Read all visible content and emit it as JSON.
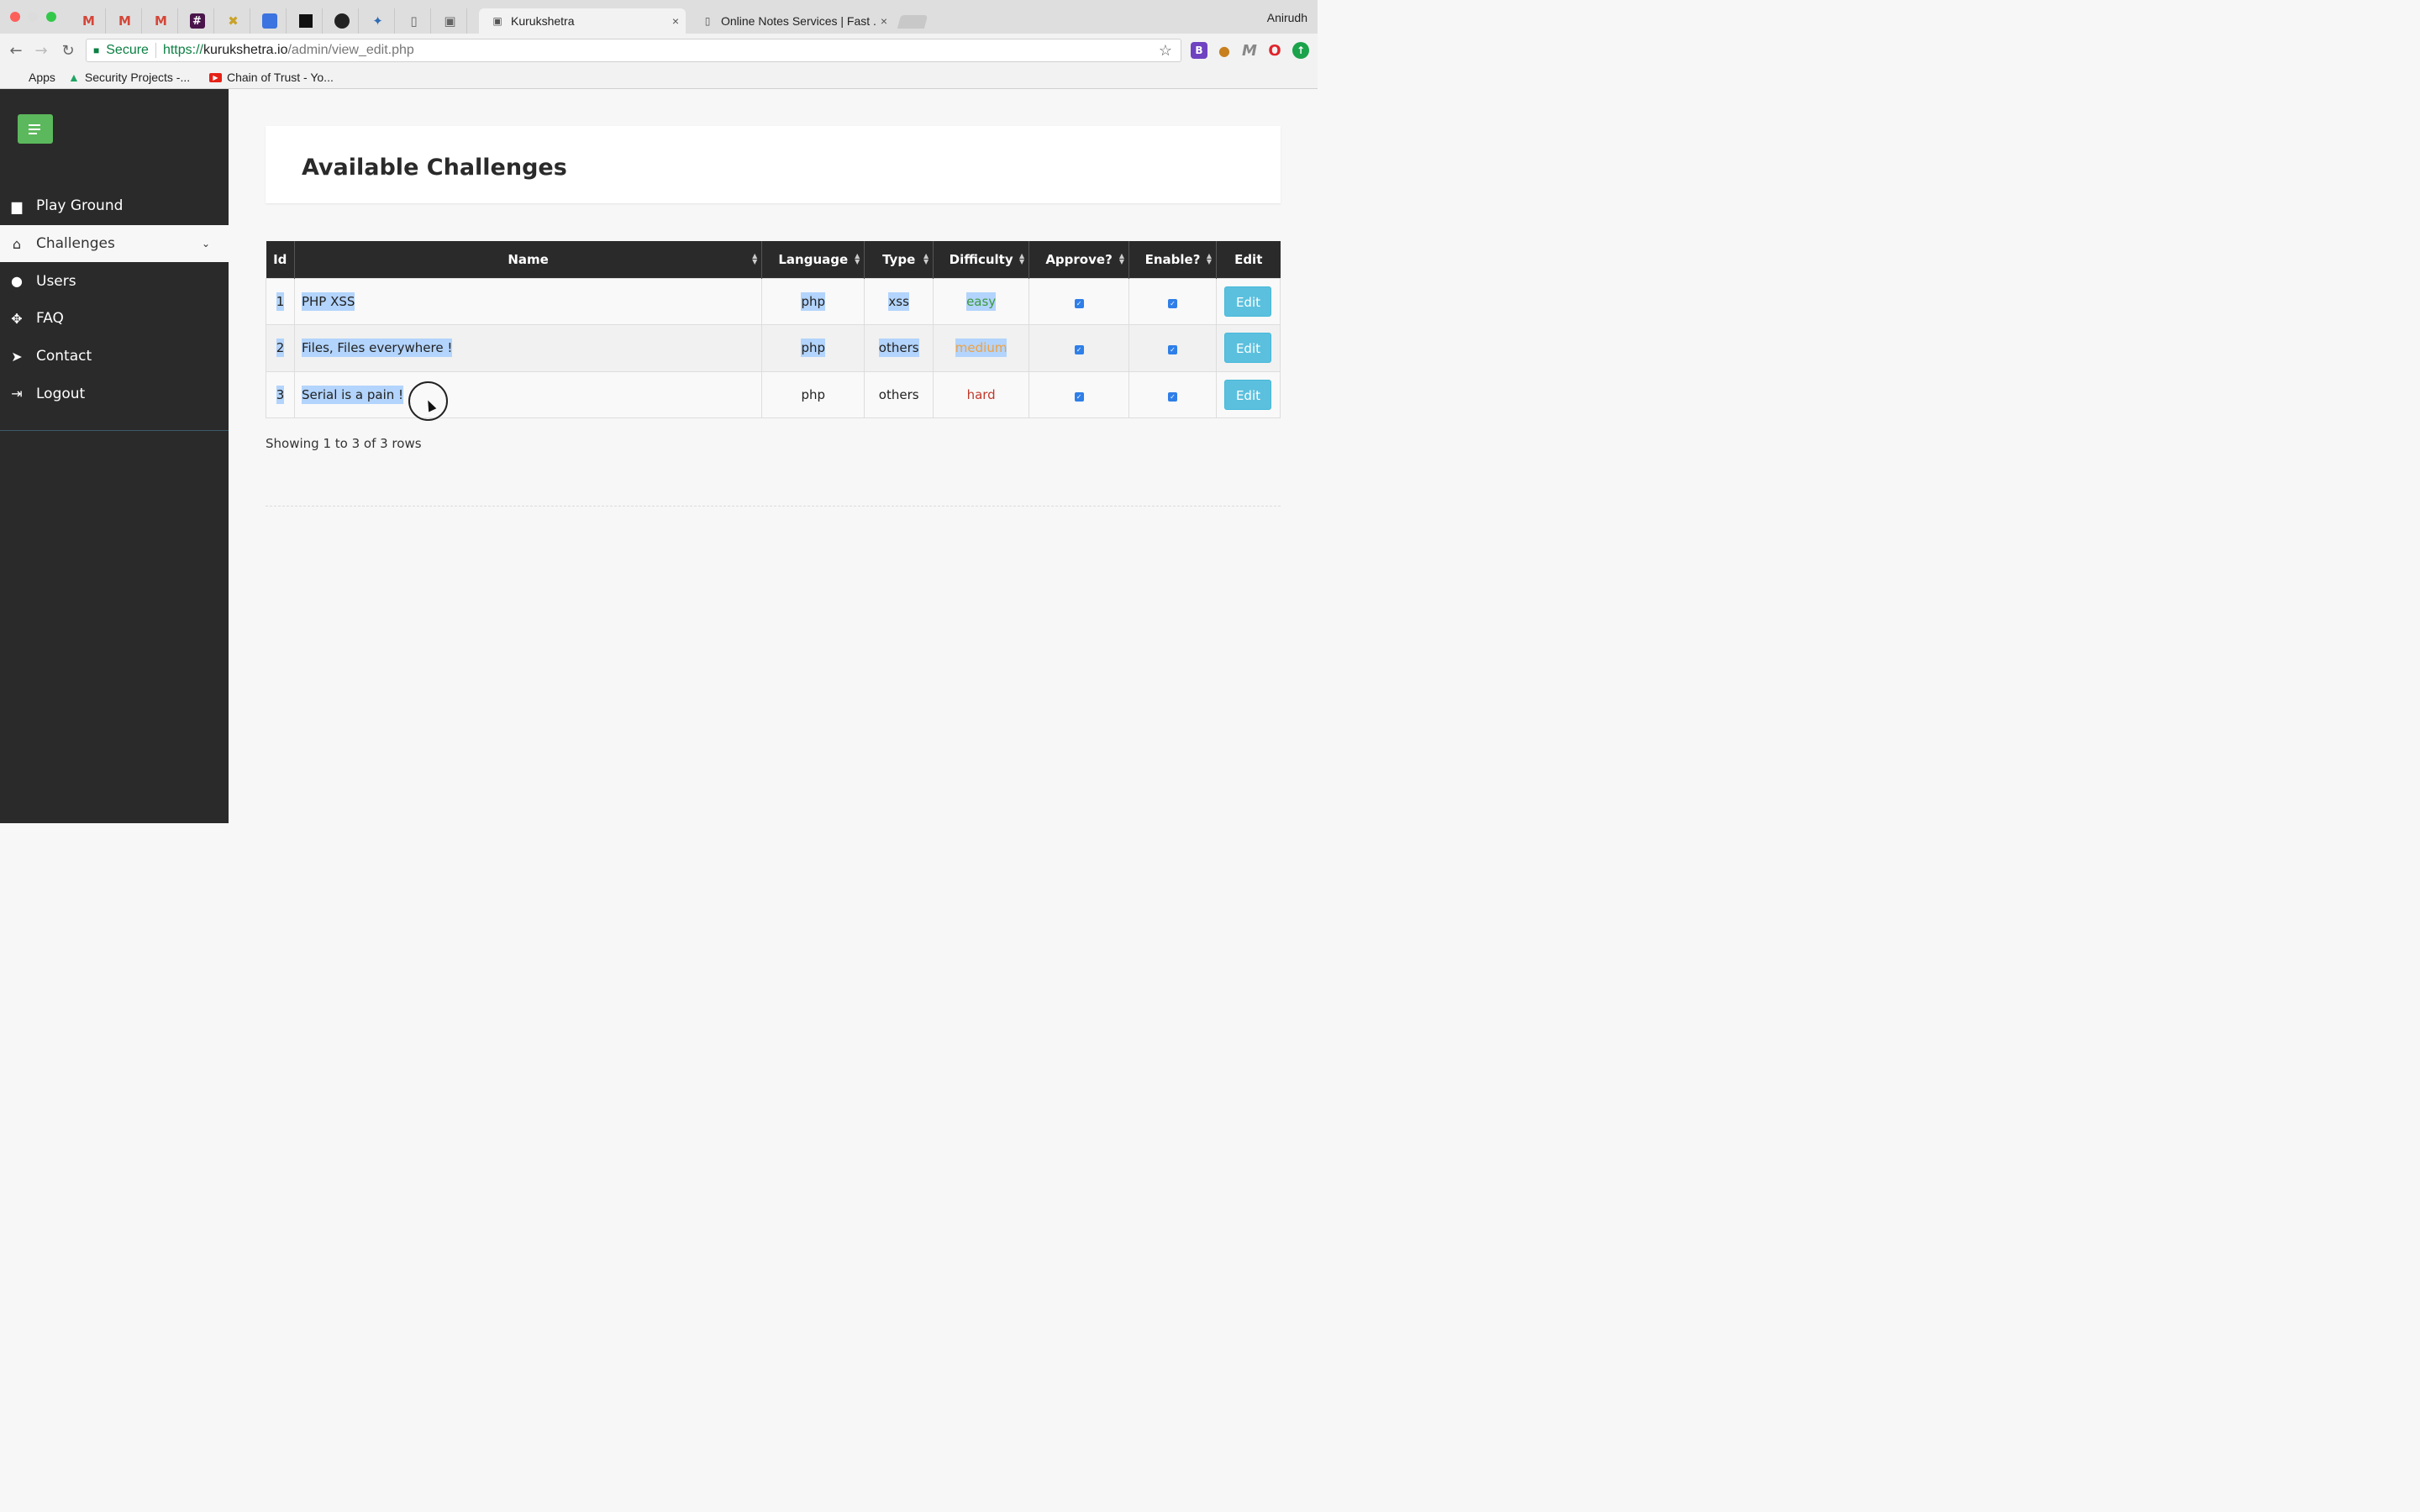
{
  "browser": {
    "profile_name": "Anirudh",
    "tabs": [
      {
        "title": "Kurukshetra",
        "active": true
      },
      {
        "title": "Online Notes Services | Fast . F",
        "active": false
      }
    ],
    "pinned_icons": [
      "gmail-icon",
      "gmail-icon",
      "gmail-icon",
      "slack-icon",
      "tab-icon",
      "tab-icon",
      "tab-icon",
      "github-icon",
      "tab-icon",
      "document-icon",
      "tab-icon"
    ],
    "security_label": "Secure",
    "url": {
      "scheme": "https://",
      "host": "kurukshetra.io",
      "path": "/admin/view_edit.php"
    },
    "bookmarks": [
      {
        "label": "Apps"
      },
      {
        "label": "Security Projects -..."
      },
      {
        "label": "Chain of Trust - Yo..."
      }
    ]
  },
  "sidebar": {
    "items": [
      {
        "label": "Play Ground",
        "icon": "briefcase-icon"
      },
      {
        "label": "Challenges",
        "icon": "home-icon",
        "active": true
      },
      {
        "label": "Users",
        "icon": "user-icon"
      },
      {
        "label": "FAQ",
        "icon": "crosshair-icon"
      },
      {
        "label": "Contact",
        "icon": "send-icon"
      },
      {
        "label": "Logout",
        "icon": "logout-icon"
      }
    ]
  },
  "main": {
    "title": "Available Challenges",
    "table": {
      "columns": [
        "Id",
        "Name",
        "Language",
        "Type",
        "Difficulty",
        "Approve?",
        "Enable?",
        "Edit"
      ],
      "rows": [
        {
          "id": "1",
          "name": "PHP XSS",
          "language": "php",
          "type": "xss",
          "difficulty": "easy",
          "approve": true,
          "enable": true,
          "edit": "Edit"
        },
        {
          "id": "2",
          "name": "Files, Files everywhere !",
          "language": "php",
          "type": "others",
          "difficulty": "medium",
          "approve": true,
          "enable": true,
          "edit": "Edit"
        },
        {
          "id": "3",
          "name": "Serial is a pain !",
          "language": "php",
          "type": "others",
          "difficulty": "hard",
          "approve": true,
          "enable": true,
          "edit": "Edit"
        }
      ]
    },
    "pagination_text": "Showing 1 to 3 of 3 rows"
  },
  "colors": {
    "easy": "#3c9a3c",
    "medium": "#f0a040",
    "hard": "#c0392b",
    "sidebar_bg": "#2a2a2a",
    "edit_button": "#5bc0de"
  }
}
